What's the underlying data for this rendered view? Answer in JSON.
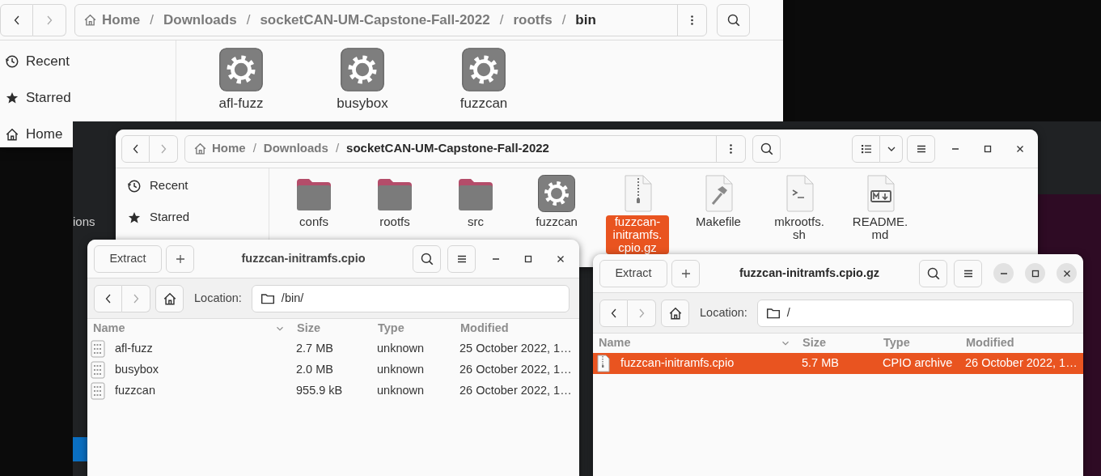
{
  "background_app": {
    "text": "ions"
  },
  "file_browsers": [
    {
      "path": {
        "separator": "/",
        "segments": [
          {
            "label": "Home",
            "kind": "home",
            "current": false
          },
          {
            "label": "Downloads",
            "kind": "folder",
            "current": false
          },
          {
            "label": "socketCAN-UM-Capstone-Fall-2022",
            "kind": "folder",
            "current": false
          },
          {
            "label": "rootfs",
            "kind": "folder",
            "current": false
          },
          {
            "label": "bin",
            "kind": "folder",
            "current": true
          }
        ]
      },
      "sidebar": [
        {
          "label": "Recent",
          "kind": "recent",
          "selected": false
        },
        {
          "label": "Starred",
          "kind": "starred",
          "selected": false
        },
        {
          "label": "Home",
          "kind": "home",
          "selected": false
        }
      ],
      "items": [
        {
          "name": "afl-fuzz",
          "kind": "executable",
          "selected": false
        },
        {
          "name": "busybox",
          "kind": "executable",
          "selected": false
        },
        {
          "name": "fuzzcan",
          "kind": "executable",
          "selected": false
        }
      ]
    },
    {
      "path": {
        "separator": "/",
        "segments": [
          {
            "label": "Home",
            "kind": "home",
            "current": false
          },
          {
            "label": "Downloads",
            "kind": "folder",
            "current": false
          },
          {
            "label": "socketCAN-UM-Capstone-Fall-2022",
            "kind": "folder",
            "current": true
          }
        ]
      },
      "window_controls": true,
      "sidebar": [
        {
          "label": "Recent",
          "kind": "recent",
          "selected": false
        },
        {
          "label": "Starred",
          "kind": "starred",
          "selected": false
        }
      ],
      "items": [
        {
          "name": "confs",
          "kind": "folder",
          "selected": false
        },
        {
          "name": "rootfs",
          "kind": "folder",
          "selected": false
        },
        {
          "name": "src",
          "kind": "folder",
          "selected": false
        },
        {
          "name": "fuzzcan",
          "kind": "executable",
          "selected": false
        },
        {
          "name": "fuzzcan-initramfs.cpio.gz",
          "kind": "archive",
          "selected": true
        },
        {
          "name": "Makefile",
          "kind": "makefile",
          "selected": false
        },
        {
          "name": "mkrootfs.sh",
          "kind": "script",
          "selected": false
        },
        {
          "name": "README.md",
          "kind": "markdown",
          "selected": false
        }
      ]
    }
  ],
  "archive_windows": [
    {
      "title": "fuzzcan-initramfs.cpio",
      "active": false,
      "extract_label": "Extract",
      "location_label": "Location:",
      "location": "/bin/",
      "columns": [
        {
          "label": "Name",
          "sorted": true
        },
        {
          "label": "Size",
          "sorted": false
        },
        {
          "label": "Type",
          "sorted": false
        },
        {
          "label": "Modified",
          "sorted": false
        }
      ],
      "rows": [
        {
          "name": "afl-fuzz",
          "kind": "binary",
          "size": "2.7 MB",
          "type": "unknown",
          "modified": "25 October 2022, 1…",
          "selected": false
        },
        {
          "name": "busybox",
          "kind": "binary",
          "size": "2.0 MB",
          "type": "unknown",
          "modified": "26 October 2022, 1…",
          "selected": false
        },
        {
          "name": "fuzzcan",
          "kind": "binary",
          "size": "955.9 kB",
          "type": "unknown",
          "modified": "26 October 2022, 1…",
          "selected": false
        }
      ]
    },
    {
      "title": "fuzzcan-initramfs.cpio.gz",
      "active": true,
      "extract_label": "Extract",
      "location_label": "Location:",
      "location": "/",
      "columns": [
        {
          "label": "Name",
          "sorted": true
        },
        {
          "label": "Size",
          "sorted": false
        },
        {
          "label": "Type",
          "sorted": false
        },
        {
          "label": "Modified",
          "sorted": false
        }
      ],
      "rows": [
        {
          "name": "fuzzcan-initramfs.cpio",
          "kind": "archive",
          "size": "5.7 MB",
          "type": "CPIO archive",
          "modified": "26 October 2022, 1…",
          "selected": true
        }
      ]
    }
  ]
}
